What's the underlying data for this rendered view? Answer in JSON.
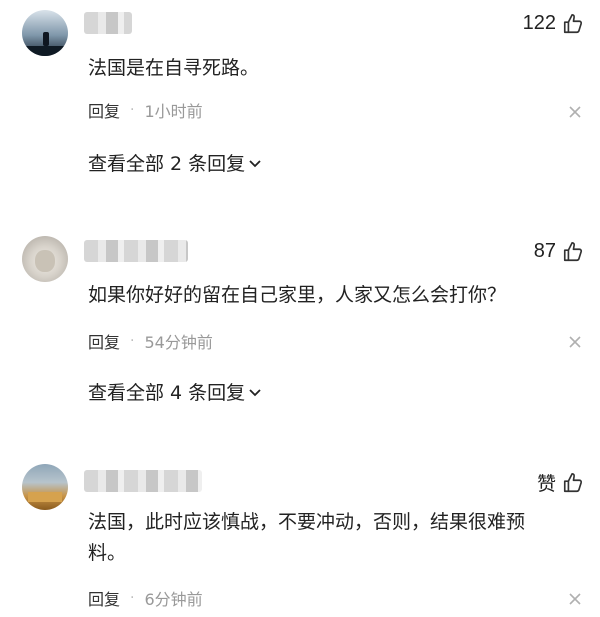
{
  "comments": [
    {
      "likes": "122",
      "text": "法国是在自寻死路。",
      "reply_label": "回复",
      "separator": "·",
      "time": "1小时前",
      "view_replies": "查看全部 2 条回复"
    },
    {
      "likes": "87",
      "text": "如果你好好的留在自己家里，人家又怎么会打你？",
      "reply_label": "回复",
      "separator": "·",
      "time": "54分钟前",
      "view_replies": "查看全部 4 条回复"
    },
    {
      "likes": "赞",
      "text": "法国，此时应该慎战，不要冲动，否则，结果很难预料。",
      "reply_label": "回复",
      "separator": "·",
      "time": "6分钟前"
    }
  ],
  "icons": {
    "like": "thumbs-up-icon",
    "close": "close-icon",
    "expand": "chevron-down-icon"
  },
  "colors": {
    "text": "#222222",
    "time": "#999999",
    "icon_gray": "#b0b0b0"
  }
}
